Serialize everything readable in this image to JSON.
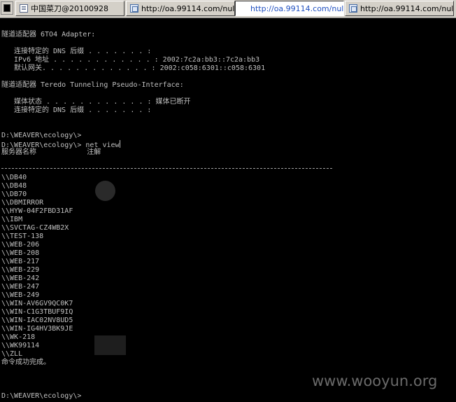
{
  "tabs": [
    {
      "label": "中国菜刀@20100928",
      "icon": "page-icon",
      "active": false
    },
    {
      "label": "http://oa.99114.com/nul...",
      "icon": "globe-icon",
      "active": false
    },
    {
      "label": "http://oa.99114.com/nul...",
      "icon": "console-icon",
      "active": true
    },
    {
      "label": "http://oa.99114.com/nul...",
      "icon": "globe-icon",
      "active": false
    }
  ],
  "console": {
    "adapter_6to4": "隧道适配器 6TO4 Adapter:",
    "dns_suffix_1": "连接特定的 DNS 后缀 . . . . . . . :",
    "ipv6_address": "IPv6 地址 . . . . . . . . . . . . : 2002:7c2a:bb3::7c2a:bb3",
    "default_gateway": "默认网关. . . . . . . . . . . . . : 2002:c058:6301::c058:6301",
    "adapter_teredo": "隧道适配器 Teredo Tunneling Pseudo-Interface:",
    "media_state": "媒体状态 . . . . . . . . . . . . : 媒体已断开",
    "dns_suffix_2": "连接特定的 DNS 后缀 . . . . . . . :",
    "prompt_1": "D:\\WEAVER\\ecology\\>",
    "prompt_2": "D:\\WEAVER\\ecology\\> net view",
    "header": "服务器名称            注解",
    "servers": [
      "\\\\DB40",
      "\\\\DB48",
      "\\\\DB70",
      "\\\\DBMIRROR",
      "\\\\HYW-04F2FBD31AF",
      "\\\\IBM",
      "\\\\SVCTAG-CZ4WB2X",
      "\\\\TEST-138",
      "\\\\WEB-206",
      "\\\\WEB-208",
      "\\\\WEB-217",
      "\\\\WEB-229",
      "\\\\WEB-242",
      "\\\\WEB-247",
      "\\\\WEB-249",
      "\\\\WIN-AV6GV9QC0K7",
      "\\\\WIN-C1G3TBUF9IQ",
      "\\\\WIN-IAC02NV8UD5",
      "\\\\WIN-IG4HV3BK9JE",
      "\\\\WK-218",
      "\\\\WK99114",
      "\\\\ZLL"
    ],
    "success": "命令成功完成。",
    "prompt_3": "D:\\WEAVER\\ecology\\>"
  },
  "watermark": "www.wooyun.org",
  "colors": {
    "console_bg": "#000000",
    "console_text": "#c0c0c0",
    "tabbar_bg": "#d4d0c8",
    "active_tab_text": "#2050c0",
    "watermark": "#6a6a6a"
  }
}
